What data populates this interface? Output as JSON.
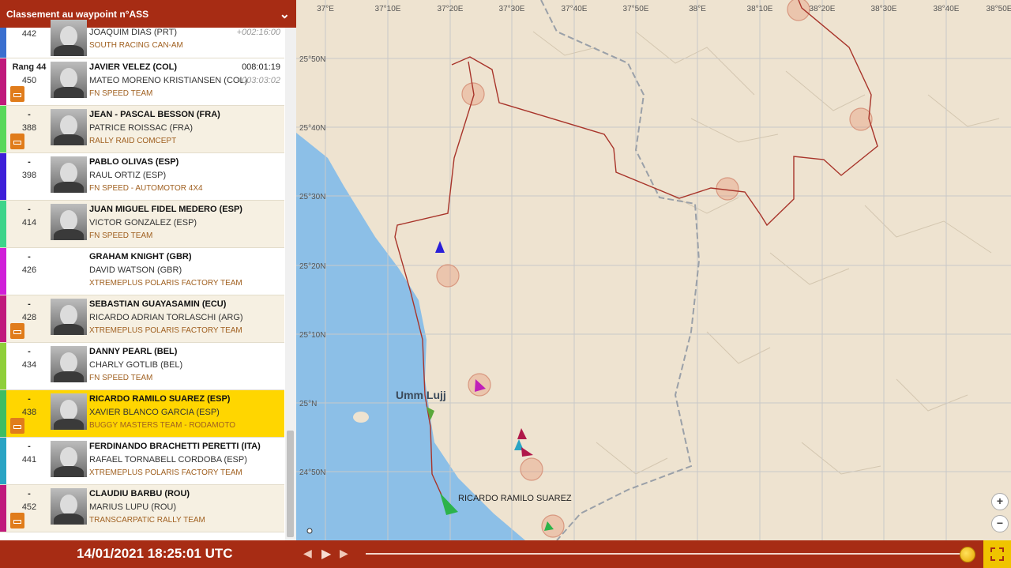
{
  "header": {
    "title": "Classement au waypoint n°ASS",
    "chevron_icon": "chevron-down-icon"
  },
  "rows": [
    {
      "rang": "",
      "num": "442",
      "driver": "",
      "codriver": "JOAQUIM DIAS (PRT)",
      "team": "SOUTH RACING CAN-AM",
      "time": "",
      "gap": "+002:16:00",
      "color": "#3a6fcf",
      "dakar": false,
      "photo": true
    },
    {
      "rang": "Rang 44",
      "num": "450",
      "driver": "JAVIER VELEZ (COL)",
      "codriver": "MATEO MORENO KRISTIANSEN (COL)",
      "team": "FN SPEED TEAM",
      "time": "008:01:19",
      "gap": "+003:03:02",
      "color": "#c0197c",
      "dakar": true,
      "photo": true
    },
    {
      "rang": "-",
      "num": "388",
      "driver": "JEAN - PASCAL BESSON (FRA)",
      "codriver": "PATRICE ROISSAC (FRA)",
      "team": "RALLY RAID COMCEPT",
      "time": "",
      "gap": "",
      "color": "#58d85a",
      "dakar": true,
      "photo": true
    },
    {
      "rang": "-",
      "num": "398",
      "driver": "PABLO OLIVAS (ESP)",
      "codriver": "RAUL ORTIZ (ESP)",
      "team": "FN SPEED - AUTOMOTOR 4X4",
      "time": "",
      "gap": "",
      "color": "#3d1fd8",
      "dakar": false,
      "photo": true
    },
    {
      "rang": "-",
      "num": "414",
      "driver": "JUAN MIGUEL FIDEL MEDERO (ESP)",
      "codriver": "VICTOR GONZALEZ (ESP)",
      "team": "FN SPEED TEAM",
      "time": "",
      "gap": "",
      "color": "#3dd48a",
      "dakar": false,
      "photo": true
    },
    {
      "rang": "-",
      "num": "426",
      "driver": "GRAHAM KNIGHT (GBR)",
      "codriver": "DAVID WATSON (GBR)",
      "team": "XTREMEPLUS POLARIS FACTORY TEAM",
      "time": "",
      "gap": "",
      "color": "#d01fd8",
      "dakar": false,
      "photo": false
    },
    {
      "rang": "-",
      "num": "428",
      "driver": "SEBASTIAN GUAYASAMIN (ECU)",
      "codriver": "RICARDO ADRIAN TORLASCHI (ARG)",
      "team": "XTREMEPLUS POLARIS FACTORY TEAM",
      "time": "",
      "gap": "",
      "color": "#c0197c",
      "dakar": true,
      "photo": true
    },
    {
      "rang": "-",
      "num": "434",
      "driver": "DANNY PEARL (BEL)",
      "codriver": "CHARLY GOTLIB (BEL)",
      "team": "FN SPEED TEAM",
      "time": "",
      "gap": "",
      "color": "#8fcf3a",
      "dakar": false,
      "photo": true
    },
    {
      "rang": "-",
      "num": "438",
      "driver": "RICARDO RAMILO SUAREZ (ESP)",
      "codriver": "XAVIER BLANCO GARCIA (ESP)",
      "team": "BUGGY MASTERS TEAM - RODAMOTO",
      "time": "",
      "gap": "",
      "color": "#3dbd63",
      "dakar": true,
      "photo": true,
      "selected": true
    },
    {
      "rang": "-",
      "num": "441",
      "driver": "FERDINANDO BRACHETTI PERETTI (ITA)",
      "codriver": "RAFAEL TORNABELL CORDOBA (ESP)",
      "team": "XTREMEPLUS POLARIS FACTORY TEAM",
      "time": "",
      "gap": "",
      "color": "#2aa4c4",
      "dakar": false,
      "photo": true
    },
    {
      "rang": "-",
      "num": "452",
      "driver": "CLAUDIU BARBU (ROU)",
      "codriver": "MARIUS LUPU (ROU)",
      "team": "TRANSCARPATIC RALLY TEAM",
      "time": "",
      "gap": "",
      "color": "#c0197c",
      "dakar": true,
      "photo": true
    }
  ],
  "map": {
    "lon_labels": [
      "37°E",
      "37°10E",
      "37°20E",
      "37°30E",
      "37°40E",
      "37°50E",
      "38°E",
      "38°10E",
      "38°20E",
      "38°30E",
      "38°40E",
      "38°50E"
    ],
    "lat_labels": [
      "25°50N",
      "25°40N",
      "25°30N",
      "25°20N",
      "25°10N",
      "25°N",
      "24°50N"
    ],
    "place": "Umm Lujj",
    "vehicle_label": "RICARDO RAMILO SUAREZ",
    "zoom_in": "+",
    "zoom_out": "−"
  },
  "footer": {
    "datetime": "14/01/2021 18:25:01 UTC",
    "prev": "◀",
    "play": "▶",
    "next": "▶",
    "fullscreen_icon": "fullscreen-icon"
  }
}
